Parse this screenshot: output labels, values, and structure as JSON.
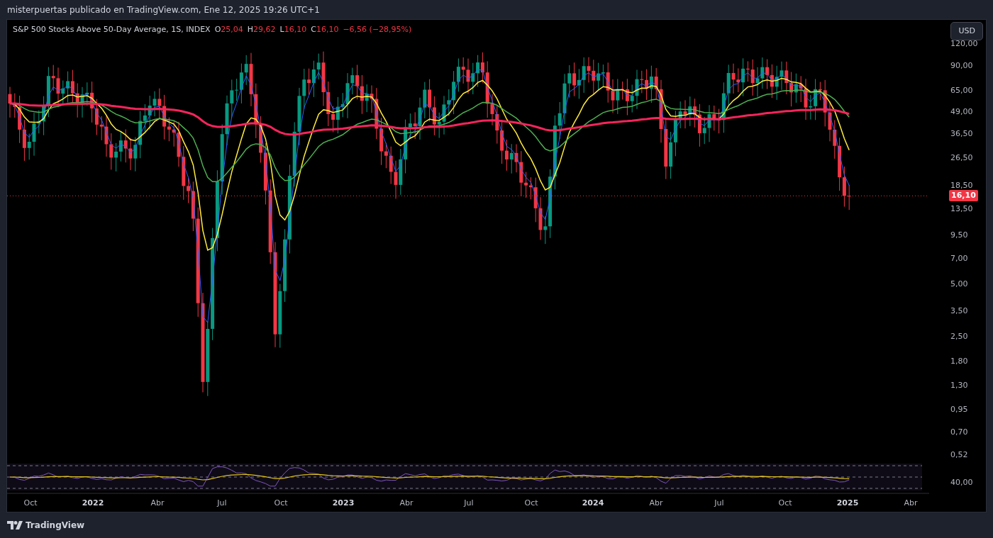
{
  "header": {
    "attribution": "misterpuertas publicado en TradingView.com, Ene 12, 2025 19:26 UTC+1"
  },
  "legend": {
    "title": "S&P 500 Stocks Above 50-Day Average, 1S, INDEX",
    "ohlc": [
      {
        "label": "O",
        "value": "25,04"
      },
      {
        "label": "H",
        "value": "29,62"
      },
      {
        "label": "L",
        "value": "16,10"
      },
      {
        "label": "C",
        "value": "16,10"
      }
    ],
    "change": "−6,56 (−28,95%)"
  },
  "currency_button": "USD",
  "price_axis": {
    "ticks": [
      "120,00",
      "90,00",
      "65,00",
      "49,00",
      "36,50",
      "26,50",
      "18,50",
      "13,50",
      "9,50",
      "7,00",
      "5,00",
      "3,50",
      "2,50",
      "1,80",
      "1,30",
      "0,95",
      "0,70",
      "0,52"
    ],
    "last_price": "16,10"
  },
  "rsi_axis": {
    "ticks": [
      "40,00"
    ]
  },
  "time_axis": [
    {
      "label": "Oct",
      "kind": "month"
    },
    {
      "label": "2022",
      "kind": "year"
    },
    {
      "label": "Abr",
      "kind": "month"
    },
    {
      "label": "Jul",
      "kind": "month"
    },
    {
      "label": "Oct",
      "kind": "month"
    },
    {
      "label": "2023",
      "kind": "year"
    },
    {
      "label": "Abr",
      "kind": "month"
    },
    {
      "label": "Jul",
      "kind": "month"
    },
    {
      "label": "Oct",
      "kind": "month"
    },
    {
      "label": "2024",
      "kind": "year"
    },
    {
      "label": "Abr",
      "kind": "month"
    },
    {
      "label": "Jul",
      "kind": "month"
    },
    {
      "label": "Oct",
      "kind": "month"
    },
    {
      "label": "2025",
      "kind": "year"
    },
    {
      "label": "Abr",
      "kind": "month"
    }
  ],
  "footer": {
    "logo": "TradingView"
  }
}
